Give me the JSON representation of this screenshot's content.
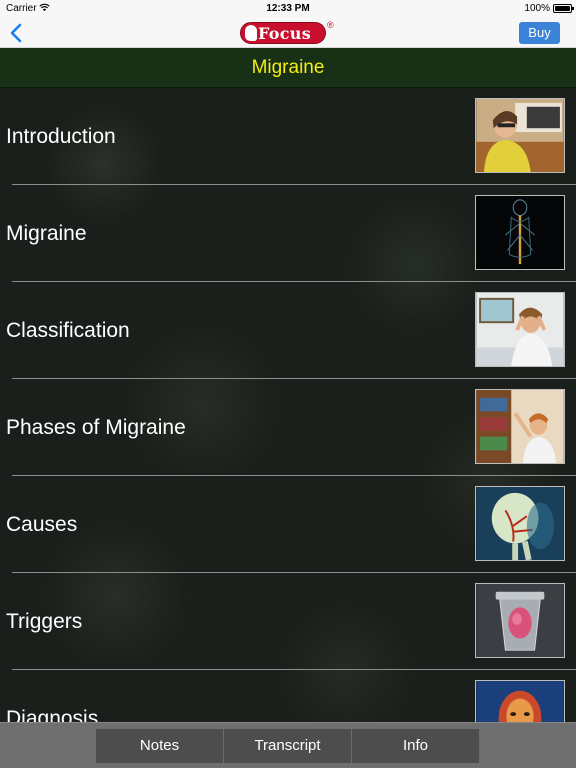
{
  "status_bar": {
    "carrier": "Carrier",
    "time": "12:33 PM",
    "battery": "100%"
  },
  "nav": {
    "logo_text": "Focus",
    "logo_mark": "®",
    "buy_label": "Buy",
    "back_icon": "chevron-left-icon"
  },
  "title": "Migraine",
  "colors": {
    "title_bar": "#173016",
    "title_text": "#f3ec15",
    "buy_button": "#3a83d6",
    "logo": "#c8102e"
  },
  "items": [
    {
      "label": "Introduction",
      "thumb": "woman-at-desk"
    },
    {
      "label": "Migraine",
      "thumb": "nervous-system"
    },
    {
      "label": "Classification",
      "thumb": "woman-headache-desk"
    },
    {
      "label": "Phases of Migraine",
      "thumb": "woman-bookshelf"
    },
    {
      "label": "Causes",
      "thumb": "skull-arteries"
    },
    {
      "label": "Triggers",
      "thumb": "trash-can-food"
    },
    {
      "label": "Diagnosis",
      "thumb": "head-scan"
    }
  ],
  "tabs": [
    "Notes",
    "Transcript",
    "Info"
  ]
}
